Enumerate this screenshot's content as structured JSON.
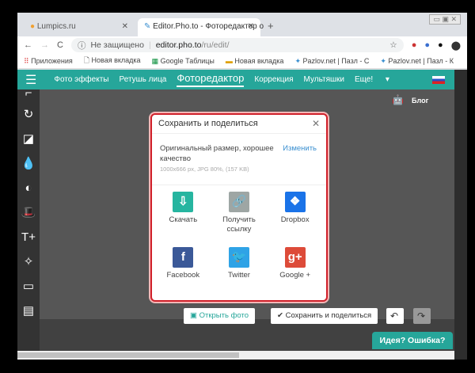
{
  "browser": {
    "tabs": [
      {
        "label": "Lumpics.ru"
      },
      {
        "label": "Editor.Pho.to - Фоторедактор о"
      }
    ],
    "not_secure": "Не защищено",
    "url_host": "editor.pho.to",
    "url_path": "/ru/edit/",
    "bookmarks": [
      "Приложения",
      "Новая вкладка",
      "Google Таблицы",
      "Новая вкладка",
      "Pazlov.net | Пазл - С",
      "Pazlov.net | Пазл - К"
    ]
  },
  "nav": {
    "items": [
      "Фото эффекты",
      "Ретушь лица",
      "Фоторедактор",
      "Коррекция",
      "Мультяшки",
      "Еще!"
    ],
    "blog": "Блог"
  },
  "dialog": {
    "title": "Сохранить и поделиться",
    "quality": "Оригинальный размер, хорошее качество",
    "details": "1000x666 px, JPG 80%, (157 KB)",
    "change": "Изменить",
    "options": [
      {
        "label": "Скачать",
        "color": "#26b5a0"
      },
      {
        "label": "Получить ссылку",
        "color": "#9ea6a4"
      },
      {
        "label": "Dropbox",
        "color": "#1a73e8"
      },
      {
        "label": "Facebook",
        "color": "#3b5998"
      },
      {
        "label": "Twitter",
        "color": "#2fa3e6"
      },
      {
        "label": "Google +",
        "color": "#dd4b39"
      }
    ]
  },
  "bottom": {
    "open_photo": "Открыть фото",
    "save_share": "Сохранить и поделиться",
    "feedback": "Идея? Ошибка?"
  }
}
